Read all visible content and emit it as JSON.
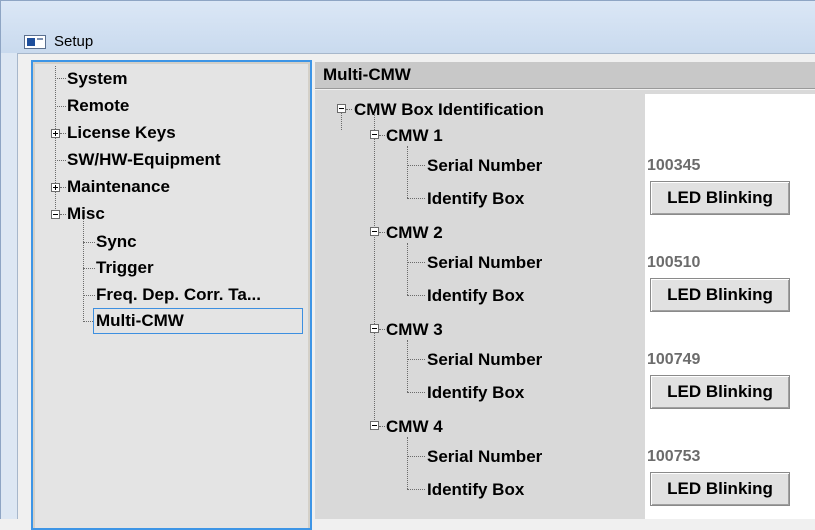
{
  "window": {
    "title": "Setup"
  },
  "tree": {
    "items": [
      {
        "label": "System"
      },
      {
        "label": "Remote"
      },
      {
        "label": "License Keys"
      },
      {
        "label": "SW/HW-Equipment"
      },
      {
        "label": "Maintenance"
      },
      {
        "label": "Misc"
      },
      {
        "label": "Sync"
      },
      {
        "label": "Trigger"
      },
      {
        "label": "Freq. Dep. Corr. Ta..."
      },
      {
        "label": "Multi-CMW"
      }
    ]
  },
  "panel": {
    "header": "Multi-CMW",
    "root_label": "CMW Box Identification",
    "boxes": [
      {
        "label": "CMW 1",
        "serial_label": "Serial Number",
        "serial_value": "100345",
        "identify_label": "Identify Box",
        "button_label": "LED Blinking"
      },
      {
        "label": "CMW 2",
        "serial_label": "Serial Number",
        "serial_value": "100510",
        "identify_label": "Identify Box",
        "button_label": "LED Blinking"
      },
      {
        "label": "CMW 3",
        "serial_label": "Serial Number",
        "serial_value": "100749",
        "identify_label": "Identify Box",
        "button_label": "LED Blinking"
      },
      {
        "label": "CMW 4",
        "serial_label": "Serial Number",
        "serial_value": "100753",
        "identify_label": "Identify Box",
        "button_label": "LED Blinking"
      }
    ]
  }
}
